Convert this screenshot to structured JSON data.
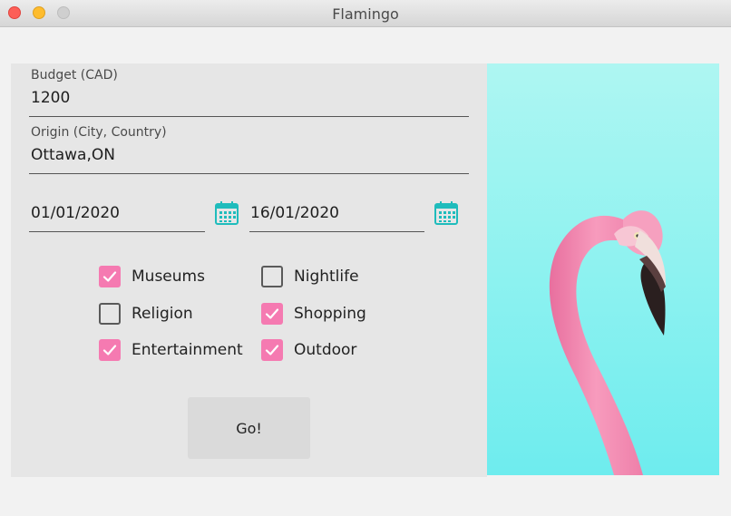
{
  "window": {
    "title": "Flamingo"
  },
  "form": {
    "budget": {
      "label": "Budget (CAD)",
      "value": "1200"
    },
    "origin": {
      "label": "Origin (City, Country)",
      "value": "Ottawa,ON"
    },
    "start_date": {
      "value": "01/01/2020",
      "icon": "calendar-icon"
    },
    "end_date": {
      "value": "16/01/2020",
      "icon": "calendar-icon"
    },
    "interests": [
      {
        "label": "Museums",
        "checked": true
      },
      {
        "label": "Nightlife",
        "checked": false
      },
      {
        "label": "Religion",
        "checked": false
      },
      {
        "label": "Shopping",
        "checked": true
      },
      {
        "label": "Entertainment",
        "checked": true
      },
      {
        "label": "Outdoor",
        "checked": true
      }
    ],
    "go_label": "Go!"
  },
  "colors": {
    "checkbox_checked": "#f57ab1",
    "calendar_icon": "#1fbcbc",
    "photo_background": "#7ef0f0",
    "flamingo": "#f58bb0"
  }
}
